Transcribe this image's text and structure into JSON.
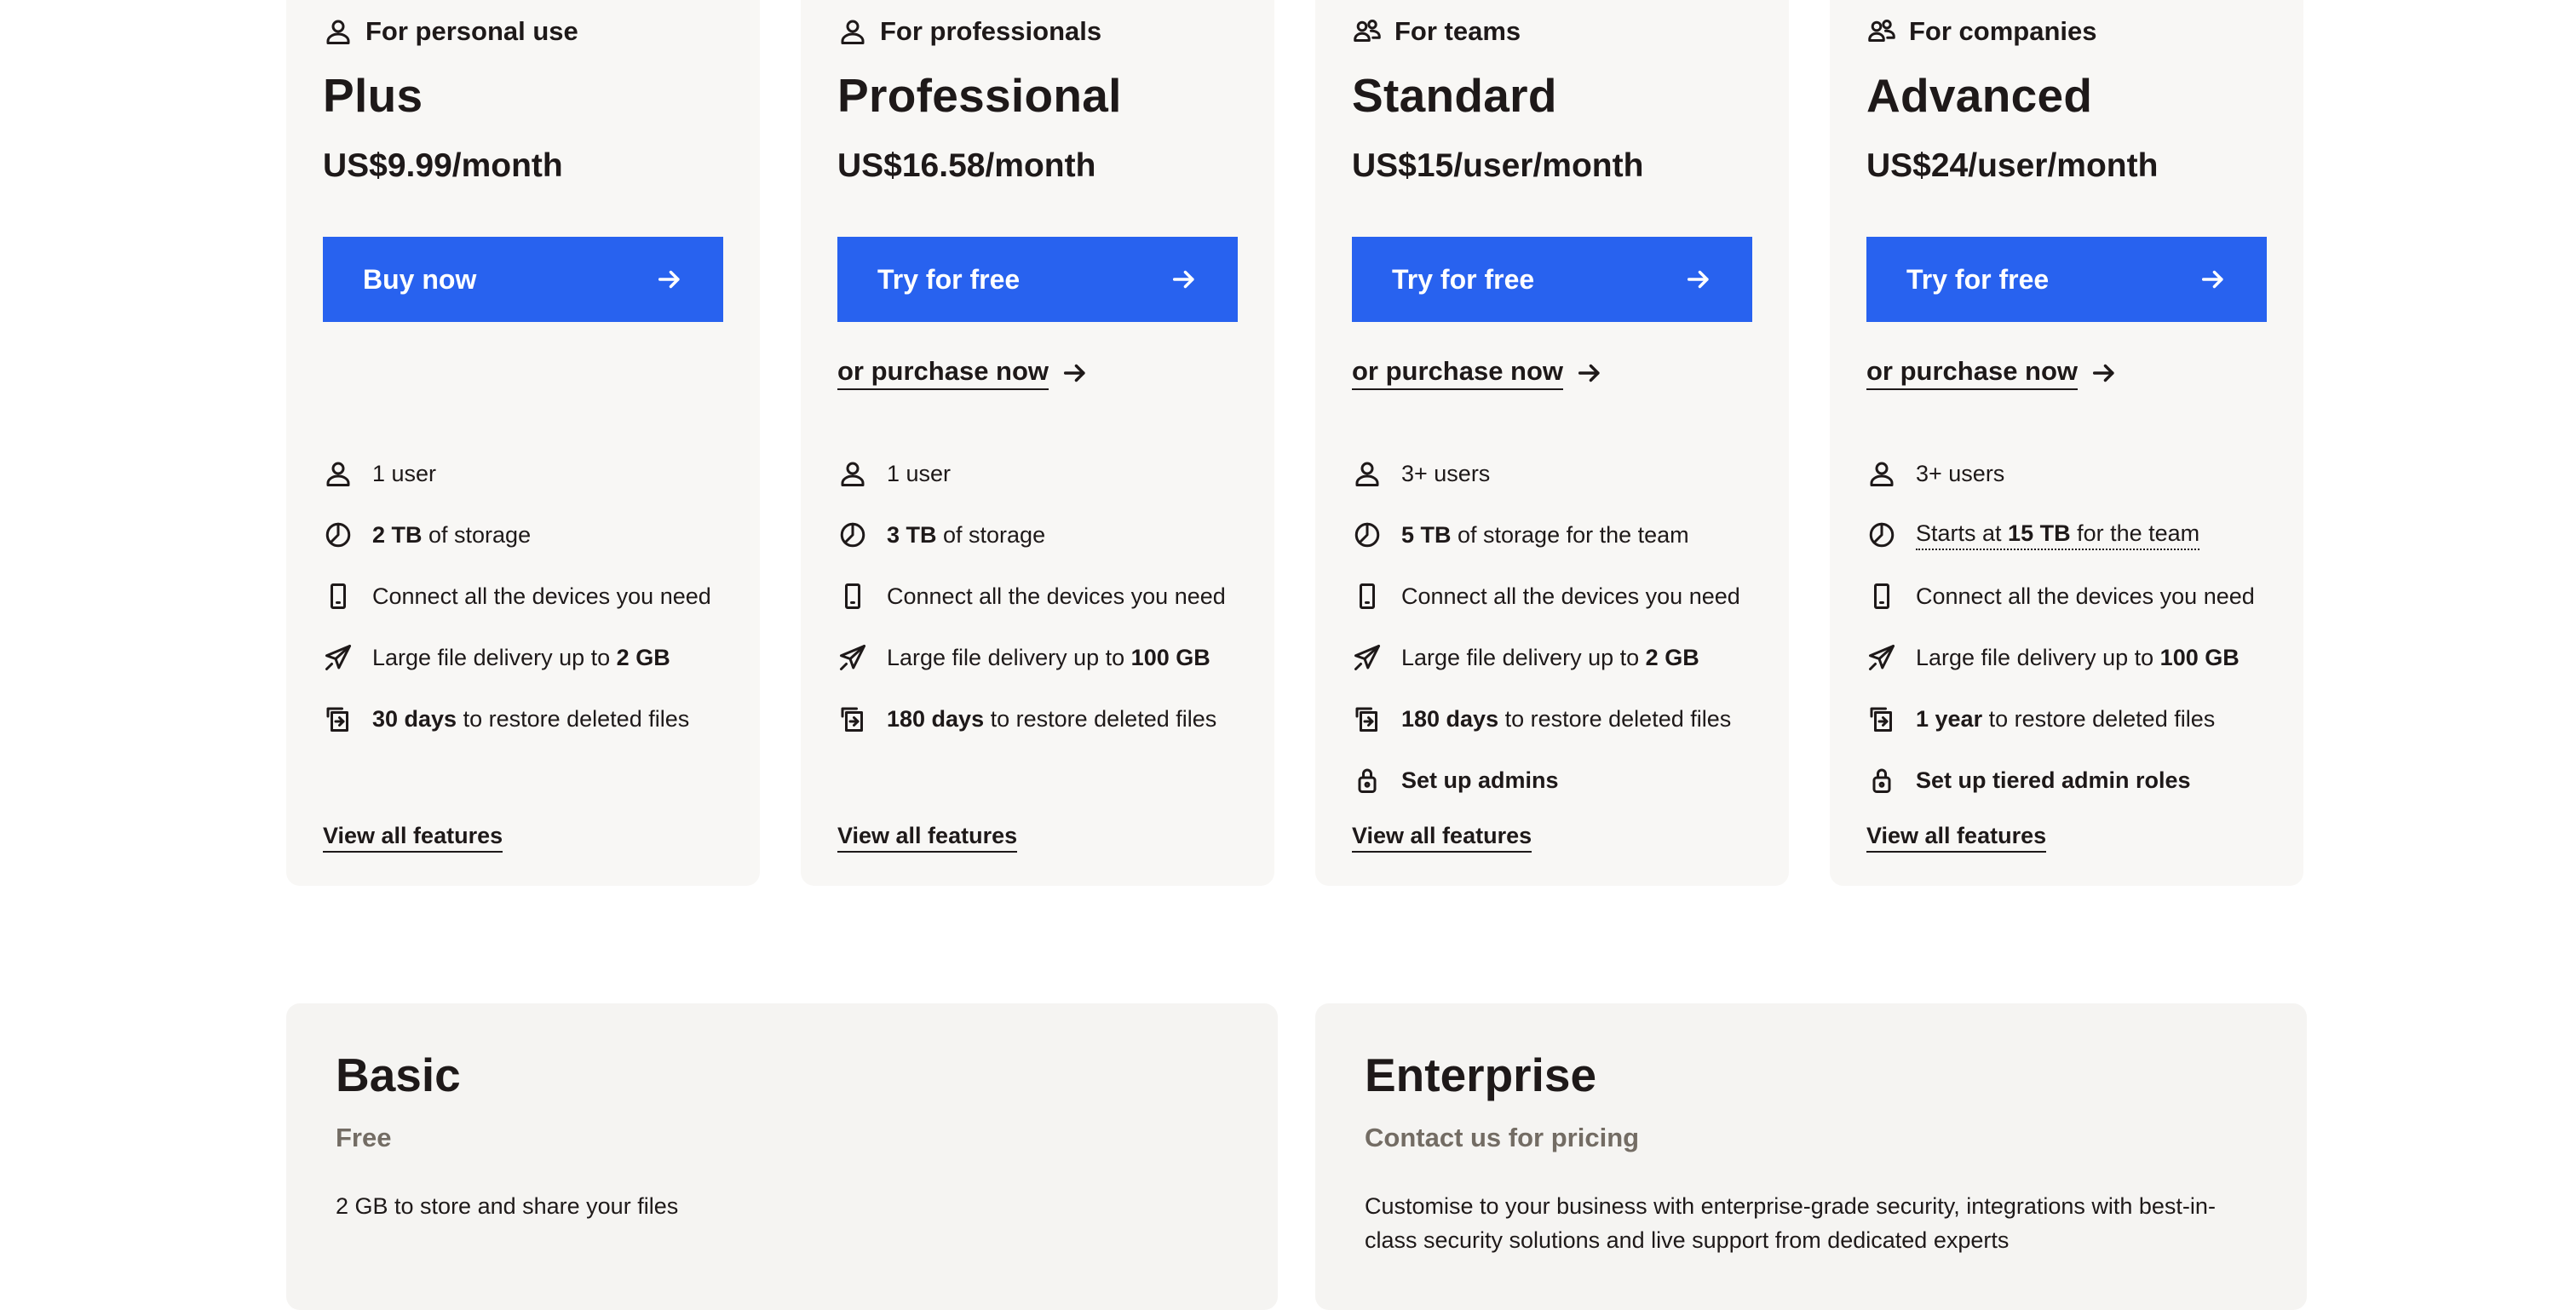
{
  "colors": {
    "accent": "#2862ef",
    "card_bg": "#f8f7f5",
    "muted_text": "#736c64",
    "text": "#1e1919"
  },
  "plans": [
    {
      "audience": "For personal use",
      "audience_icon": "person-icon",
      "name": "Plus",
      "price": "US$9.99/month",
      "cta": "Buy now",
      "purchase": "",
      "features": [
        {
          "icon": "person-icon",
          "parts": [
            {
              "t": "1 user"
            }
          ]
        },
        {
          "icon": "storage-pie-icon",
          "parts": [
            {
              "t": "2 TB",
              "b": true
            },
            {
              "t": " of storage"
            }
          ]
        },
        {
          "icon": "mobile-device-icon",
          "parts": [
            {
              "t": "Connect all the devices you need"
            }
          ]
        },
        {
          "icon": "send-plane-icon",
          "parts": [
            {
              "t": "Large file delivery up to "
            },
            {
              "t": "2 GB",
              "b": true
            }
          ]
        },
        {
          "icon": "restore-files-icon",
          "parts": [
            {
              "t": "30 days",
              "b": true
            },
            {
              "t": " to restore deleted files"
            }
          ]
        }
      ],
      "view_all": "View all features"
    },
    {
      "audience": "For professionals",
      "audience_icon": "person-icon",
      "name": "Professional",
      "price": "US$16.58/month",
      "cta": "Try for free",
      "purchase": "or purchase now",
      "features": [
        {
          "icon": "person-icon",
          "parts": [
            {
              "t": "1 user"
            }
          ]
        },
        {
          "icon": "storage-pie-icon",
          "parts": [
            {
              "t": "3 TB",
              "b": true
            },
            {
              "t": " of storage"
            }
          ]
        },
        {
          "icon": "mobile-device-icon",
          "parts": [
            {
              "t": "Connect all the devices you need"
            }
          ]
        },
        {
          "icon": "send-plane-icon",
          "parts": [
            {
              "t": "Large file delivery up to "
            },
            {
              "t": "100 GB",
              "b": true
            }
          ]
        },
        {
          "icon": "restore-files-icon",
          "parts": [
            {
              "t": "180 days",
              "b": true
            },
            {
              "t": " to restore deleted files"
            }
          ]
        }
      ],
      "view_all": "View all features"
    },
    {
      "audience": "For teams",
      "audience_icon": "team-icon",
      "name": "Standard",
      "price": "US$15/user/month",
      "cta": "Try for free",
      "purchase": "or purchase now",
      "features": [
        {
          "icon": "person-icon",
          "parts": [
            {
              "t": "3+ users"
            }
          ]
        },
        {
          "icon": "storage-pie-icon",
          "parts": [
            {
              "t": "5 TB",
              "b": true
            },
            {
              "t": " of storage for the team"
            }
          ]
        },
        {
          "icon": "mobile-device-icon",
          "parts": [
            {
              "t": "Connect all the devices you need"
            }
          ]
        },
        {
          "icon": "send-plane-icon",
          "parts": [
            {
              "t": "Large file delivery up to "
            },
            {
              "t": "2 GB",
              "b": true
            }
          ]
        },
        {
          "icon": "restore-files-icon",
          "parts": [
            {
              "t": "180 days",
              "b": true
            },
            {
              "t": " to restore deleted files"
            }
          ]
        },
        {
          "icon": "lock-icon",
          "parts": [
            {
              "t": "Set up admins",
              "b": true
            }
          ]
        }
      ],
      "view_all": "View all features"
    },
    {
      "audience": "For companies",
      "audience_icon": "team-icon",
      "name": "Advanced",
      "price": "US$24/user/month",
      "cta": "Try for free",
      "purchase": "or purchase now",
      "features": [
        {
          "icon": "person-icon",
          "parts": [
            {
              "t": "3+ users"
            }
          ]
        },
        {
          "icon": "storage-pie-icon",
          "dotted": true,
          "parts": [
            {
              "t": "Starts at "
            },
            {
              "t": "15 TB",
              "b": true
            },
            {
              "t": " for the team"
            }
          ]
        },
        {
          "icon": "mobile-device-icon",
          "parts": [
            {
              "t": "Connect all the devices you need"
            }
          ]
        },
        {
          "icon": "send-plane-icon",
          "parts": [
            {
              "t": "Large file delivery up to "
            },
            {
              "t": "100 GB",
              "b": true
            }
          ]
        },
        {
          "icon": "restore-files-icon",
          "parts": [
            {
              "t": "1 year",
              "b": true
            },
            {
              "t": " to restore deleted files"
            }
          ]
        },
        {
          "icon": "lock-icon",
          "parts": [
            {
              "t": "Set up tiered admin roles",
              "b": true
            }
          ]
        }
      ],
      "view_all": "View all features"
    }
  ],
  "basic": {
    "name": "Basic",
    "price": "Free",
    "description": "2 GB to store and share your files"
  },
  "enterprise": {
    "name": "Enterprise",
    "price": "Contact us for pricing",
    "description": "Customise to your business with enterprise-grade security, integrations with best-in-class security solutions and live support from dedicated experts"
  }
}
